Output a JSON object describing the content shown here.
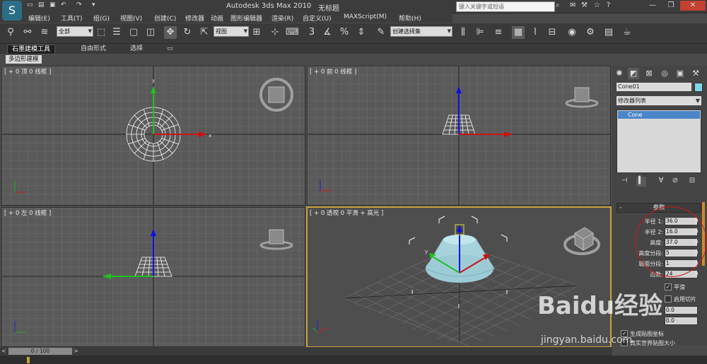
{
  "window": {
    "app_title": "Autodesk 3ds Max  2010",
    "doc_title": "无标题",
    "search_placeholder": "键入关键字或短语"
  },
  "menu": [
    "编辑(E)",
    "工具(T)",
    "组(G)",
    "视图(V)",
    "创建(C)",
    "修改器",
    "动画",
    "图形编辑器",
    "渲染(R)",
    "自定义(U)",
    "MAXScript(M)",
    "帮助(H)"
  ],
  "toolbar": {
    "selection_filter": "全部",
    "reference_coord": "视图",
    "named_selection": "创建选择集"
  },
  "ribbon": {
    "tabs": [
      "石墨建模工具",
      "自由形式",
      "选择"
    ],
    "subtab": "多边形建模"
  },
  "viewports": [
    {
      "label": "[ + 0 顶 0 线框 ]"
    },
    {
      "label": "[ + 0 前 0 线框 ]"
    },
    {
      "label": "[ + 0 左 0 线框 ]"
    },
    {
      "label": "[ + 0 透视 0 平滑 + 高光 ]"
    }
  ],
  "command_panel": {
    "object_name": "Cone01",
    "object_color": "#7fd6e6",
    "modifier_list": "修改器列表",
    "stack_item": "Cone",
    "rollout_title": "参数",
    "params": [
      {
        "label": "半径 1:",
        "value": "36.0"
      },
      {
        "label": "半径 2:",
        "value": "16.0"
      },
      {
        "label": "高度:",
        "value": "37.0"
      },
      {
        "label": "高度分段:",
        "value": "5"
      },
      {
        "label": "端面分段:",
        "value": "1"
      },
      {
        "label": "边数:",
        "value": "24"
      }
    ],
    "smooth_label": "平滑",
    "slice_label": "启用切片",
    "slice_from": "0.0",
    "slice_to": "0.0",
    "gen_map_label": "生成贴图坐标",
    "real_world_label": "真实世界贴图大小"
  },
  "timeline": {
    "frame_display": "0 / 100"
  },
  "watermark": {
    "brand": "Baidu经验",
    "url": "jingyan.baidu.com"
  }
}
